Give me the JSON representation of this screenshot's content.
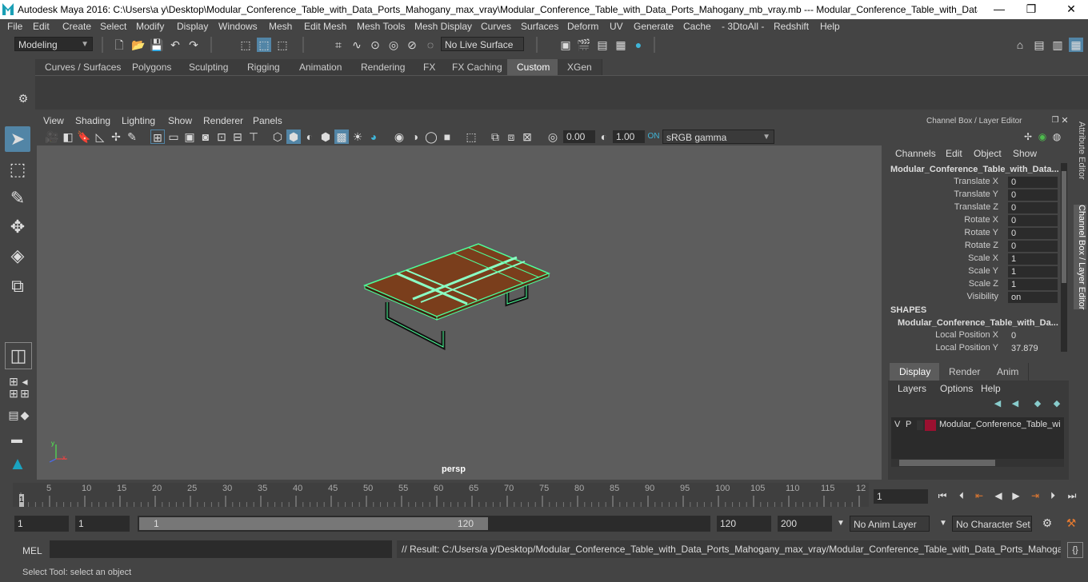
{
  "window": {
    "title": "Autodesk Maya 2016: C:\\Users\\a y\\Desktop\\Modular_Conference_Table_with_Data_Ports_Mahogany_max_vray\\Modular_Conference_Table_with_Data_Ports_Mahogany_mb_vray.mb   ---   Modular_Conference_Table_with_Data...",
    "minimize": "—",
    "maximize": "❐",
    "close": "✕"
  },
  "menubar": [
    "File",
    "Edit",
    "Create",
    "Select",
    "Modify",
    "Display",
    "Windows",
    "Mesh",
    "Edit Mesh",
    "Mesh Tools",
    "Mesh Display",
    "Curves",
    "Surfaces",
    "Deform",
    "UV",
    "Generate",
    "Cache",
    "- 3DtoAll -",
    "Redshift",
    "Help"
  ],
  "status": {
    "mode": "Modeling",
    "live_surface": "No Live Surface"
  },
  "shelf_tabs": [
    "Curves / Surfaces",
    "Polygons",
    "Sculpting",
    "Rigging",
    "Animation",
    "Rendering",
    "FX",
    "FX Caching",
    "Custom",
    "XGen"
  ],
  "shelf_active": "Custom",
  "viewport": {
    "menus": [
      "View",
      "Shading",
      "Lighting",
      "Show",
      "Renderer",
      "Panels"
    ],
    "exposure": "0.00",
    "gamma": "1.00",
    "colorspace": "sRGB gamma",
    "camera_label": "persp"
  },
  "channel_box": {
    "panel_title": "Channel Box / Layer Editor",
    "menus": [
      "Channels",
      "Edit",
      "Object",
      "Show"
    ],
    "object_name": "Modular_Conference_Table_with_Data...",
    "attributes": [
      {
        "label": "Translate X",
        "value": "0"
      },
      {
        "label": "Translate Y",
        "value": "0"
      },
      {
        "label": "Translate Z",
        "value": "0"
      },
      {
        "label": "Rotate X",
        "value": "0"
      },
      {
        "label": "Rotate Y",
        "value": "0"
      },
      {
        "label": "Rotate Z",
        "value": "0"
      },
      {
        "label": "Scale X",
        "value": "1"
      },
      {
        "label": "Scale Y",
        "value": "1"
      },
      {
        "label": "Scale Z",
        "value": "1"
      },
      {
        "label": "Visibility",
        "value": "on"
      }
    ],
    "shapes_header": "SHAPES",
    "shape_name": "Modular_Conference_Table_with_Da...",
    "shape_attributes": [
      {
        "label": "Local Position X",
        "value": "0"
      },
      {
        "label": "Local Position Y",
        "value": "37.879"
      }
    ]
  },
  "side_tabs": [
    "Attribute Editor",
    "Channel Box / Layer Editor"
  ],
  "layer_editor": {
    "tabs": [
      "Display",
      "Render",
      "Anim"
    ],
    "menus": [
      "Layers",
      "Options",
      "Help"
    ],
    "layer": {
      "v": "V",
      "p": "P",
      "name": "Modular_Conference_Table_wi",
      "color": "#9b1030"
    }
  },
  "timeline": {
    "ticks": [
      "5",
      "10",
      "15",
      "20",
      "25",
      "30",
      "35",
      "40",
      "45",
      "50",
      "55",
      "60",
      "65",
      "70",
      "75",
      "80",
      "85",
      "90",
      "95",
      "100",
      "105",
      "110",
      "115",
      "12"
    ],
    "start_marker": "1",
    "current_frame": "1"
  },
  "range": {
    "start": "1",
    "playback_start": "1",
    "slider_start": "1",
    "slider_end": "120",
    "playback_end": "120",
    "end": "200",
    "anim_layer": "No Anim Layer",
    "character_set": "No Character Set"
  },
  "command": {
    "lang": "MEL",
    "result": "// Result: C:/Users/a y/Desktop/Modular_Conference_Table_with_Data_Ports_Mahogany_max_vray/Modular_Conference_Table_with_Data_Ports_Mahogany_mb_v"
  },
  "help_line": "Select Tool: select an object",
  "colors": {
    "accent": "#5285a6",
    "wireframe": "#4dff9a",
    "wood": "#7a3e1c",
    "viewport_bg": "#5d5d5d"
  }
}
